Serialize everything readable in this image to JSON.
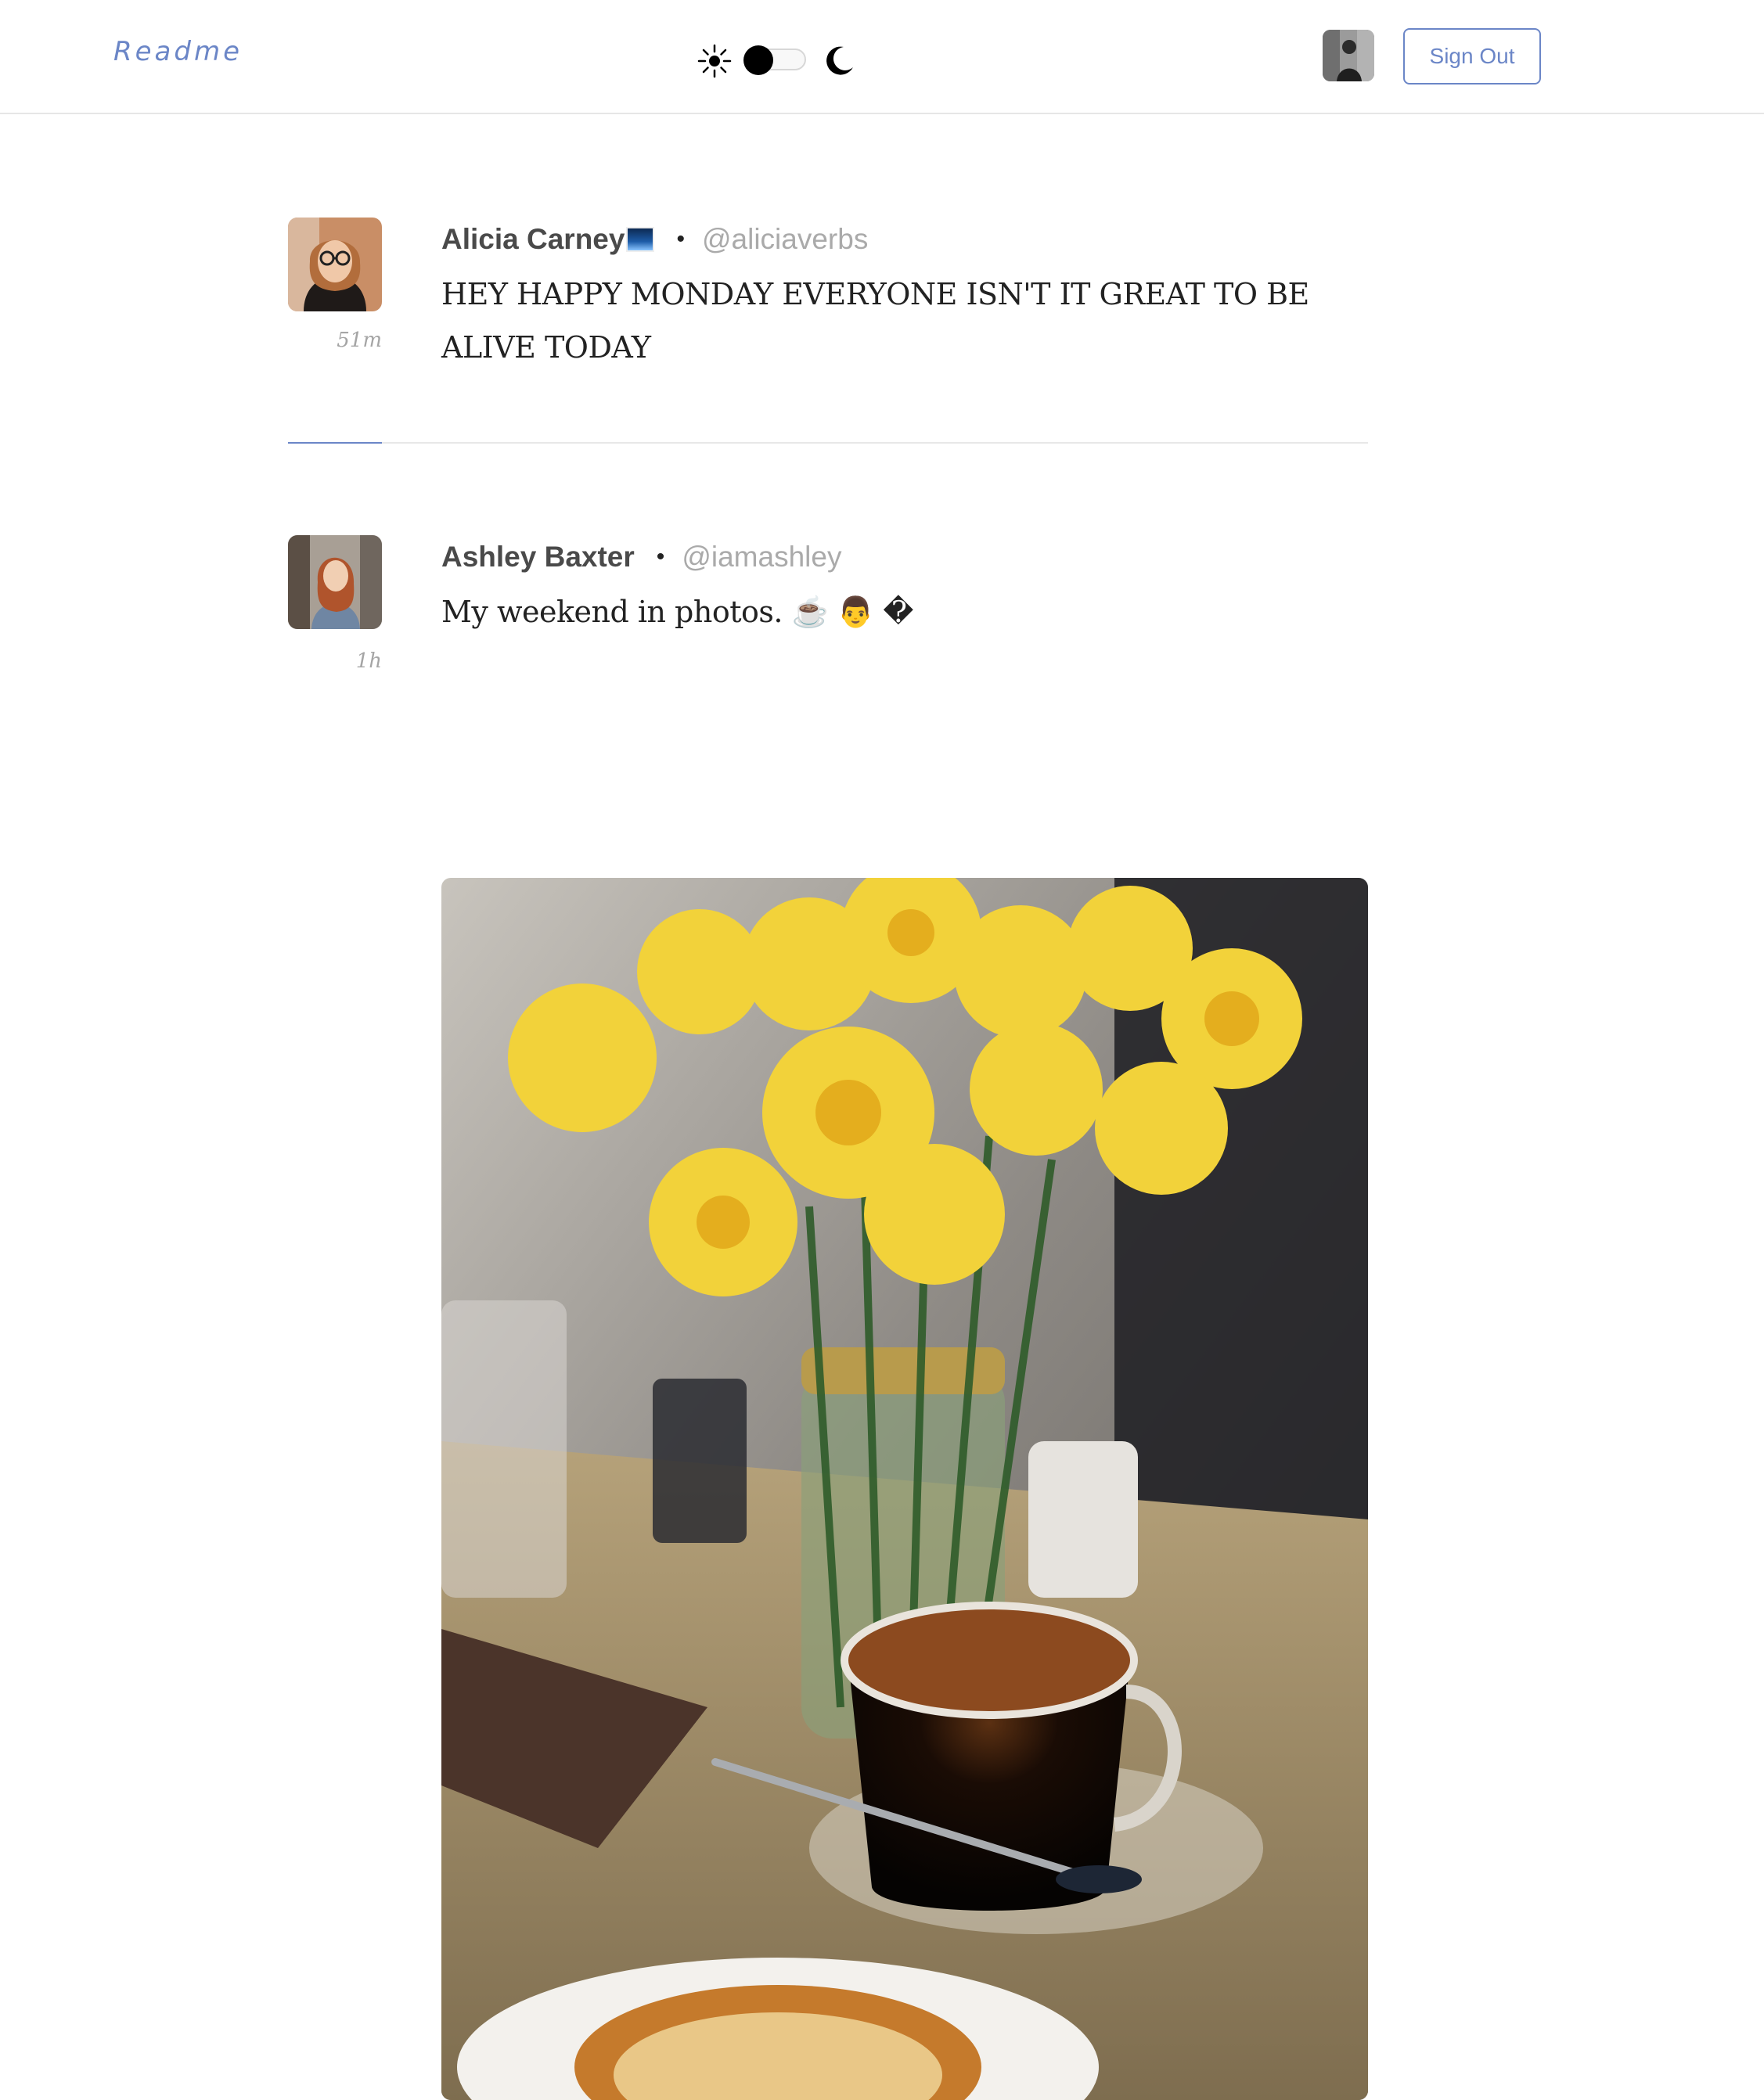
{
  "header": {
    "brand": "Readme",
    "signout_label": "Sign Out",
    "toggle": {
      "state": "light"
    }
  },
  "posts": [
    {
      "author": "Alicia Carney",
      "handle": "@aliciaverbs",
      "time": "51m",
      "text": "HEY HAPPY MONDAY EVERYONE ISN'T IT GREAT TO BE ALIVE TODAY"
    },
    {
      "author": "Ashley Baxter",
      "handle": "@iamashley",
      "time": "1h",
      "text": "My weekend in photos. ☕ 👨 �"
    }
  ],
  "colors": {
    "accent": "#6b86c7",
    "muted": "#aaaaaa",
    "text": "#222222"
  }
}
